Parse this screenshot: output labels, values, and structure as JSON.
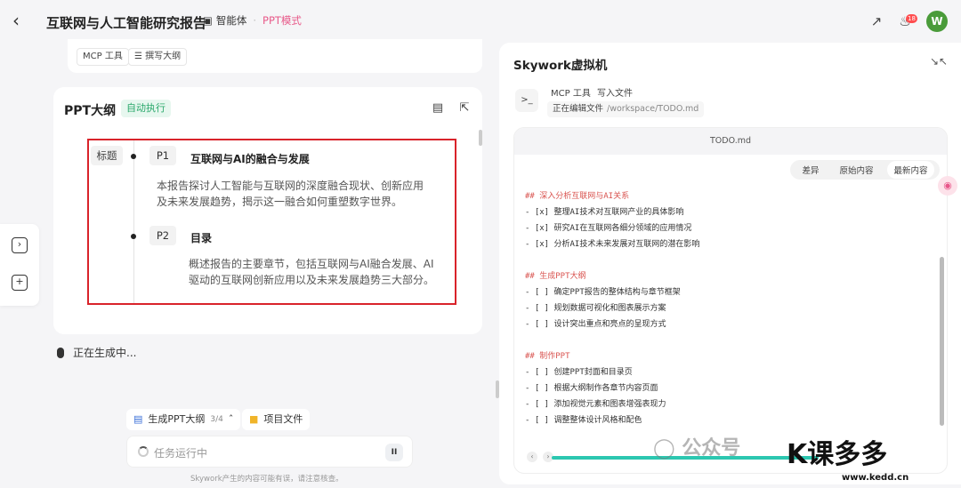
{
  "header": {
    "back_icon": "arrow-left-icon",
    "title": "互联网与人工智能研究报告",
    "agent_label": "智能体",
    "mode_label": "PPT模式",
    "share_icon": "share-icon",
    "bell_icon": "bell-icon",
    "bell_badge": "18",
    "avatar_letter": "W",
    "avatar_color": "#4a9b3a"
  },
  "top_card": {
    "chips": [
      "MCP 工具",
      "撰写大纲"
    ]
  },
  "outline": {
    "title": "PPT大纲",
    "badge": "自动执行",
    "label_col": "标题",
    "items": [
      {
        "page": "P1",
        "heading": "互联网与AI的融合与发展",
        "desc": "本报告探讨人工智能与互联网的深度融合现状、创新应用及未来发展趋势，揭示这一融合如何重塑数字世界。"
      },
      {
        "page": "P2",
        "heading": "目录",
        "desc": "概述报告的主要章节，包括互联网与AI融合发展、AI驱动的互联网创新应用以及未来发展趋势三大部分。"
      }
    ]
  },
  "status": {
    "generating": "正在生成中..."
  },
  "bottom": {
    "ppt_chip": "生成PPT大纲",
    "ppt_count": "3/4",
    "files_chip": "项目文件",
    "input_placeholder": "任务运行中",
    "pause_label": "II",
    "disclaimer": "Skywork产生的内容可能有误，请注意核查。"
  },
  "vm": {
    "title": "Skywork虚拟机",
    "tool_name": "MCP 工具",
    "tool_action": "写入文件",
    "editing_label": "正在编辑文件",
    "path": "/workspace/TODO.md",
    "file_name": "TODO.md",
    "tabs": [
      "差异",
      "原始内容",
      "最新内容"
    ],
    "active_tab": "最新内容",
    "lines": [
      {
        "text": "## 深入分析互联网与AI关系",
        "head": true
      },
      {
        "text": "- [x] 整理AI技术对互联网产业的具体影响",
        "head": false
      },
      {
        "text": "- [x] 研究AI在互联网各细分领域的应用情况",
        "head": false
      },
      {
        "text": "- [x] 分析AI技术未来发展对互联网的潜在影响",
        "head": false
      },
      {
        "text": "",
        "head": false
      },
      {
        "text": "## 生成PPT大纲",
        "head": true
      },
      {
        "text": "- [ ] 确定PPT报告的整体结构与章节框架",
        "head": false
      },
      {
        "text": "- [ ] 规划数据可视化和图表展示方案",
        "head": false
      },
      {
        "text": "- [ ] 设计突出重点和亮点的呈现方式",
        "head": false
      },
      {
        "text": "",
        "head": false
      },
      {
        "text": "## 制作PPT",
        "head": true
      },
      {
        "text": "- [ ] 创建PPT封面和目录页",
        "head": false
      },
      {
        "text": "- [ ] 根据大纲制作各章节内容页面",
        "head": false
      },
      {
        "text": "- [ ] 添加视觉元素和图表增强表现力",
        "head": false
      },
      {
        "text": "- [ ] 调整整体设计风格和配色",
        "head": false
      }
    ]
  },
  "watermark": {
    "wechat": "公众号",
    "logo": "课多多",
    "url": "www.kedd.cn"
  }
}
